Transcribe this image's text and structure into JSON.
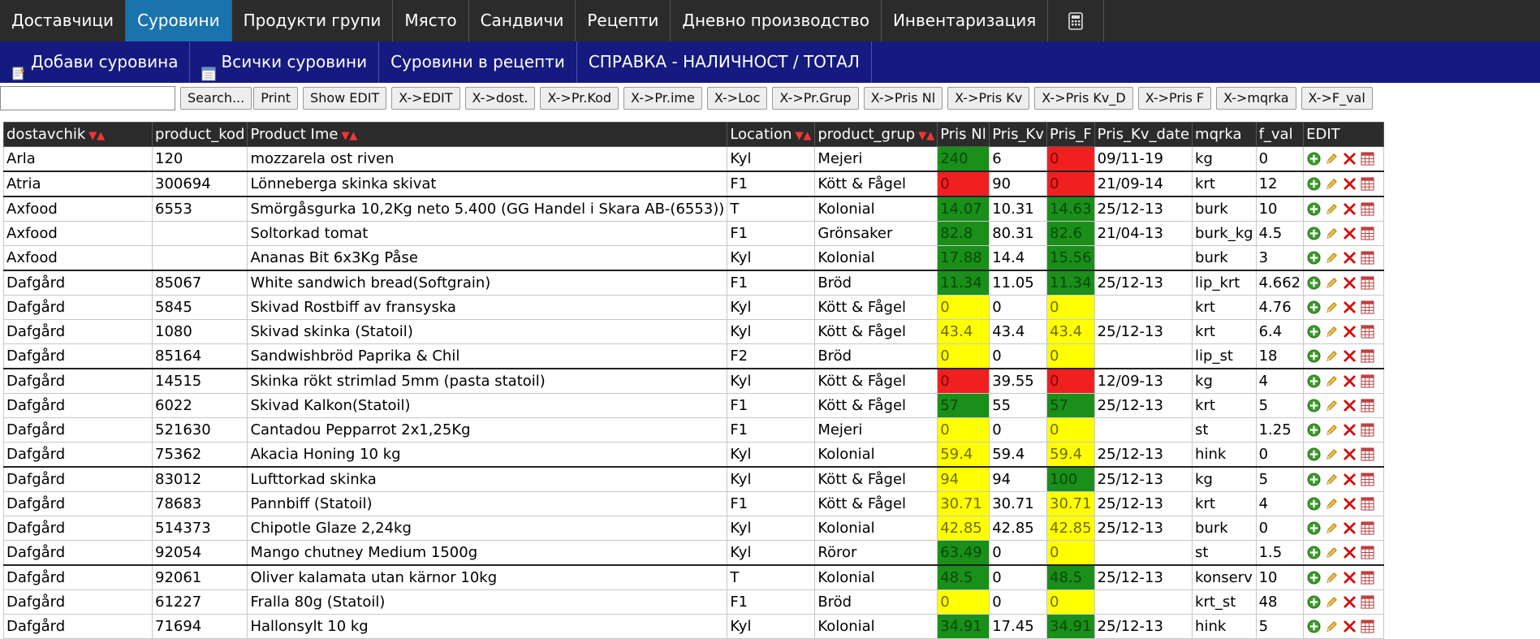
{
  "topnav": [
    "Доставчици",
    "Суровини",
    "Продукти групи",
    "Място",
    "Сандвичи",
    "Рецепти",
    "Дневно производство",
    "Инвентаризация"
  ],
  "subnav": [
    "Добави суровина",
    "Всички суровини",
    "Суровини в рецепти",
    "СПРАВКА - НАЛИЧНОСТ / ТОТАЛ"
  ],
  "toolbar": {
    "search_value": "",
    "buttons": [
      "Search...",
      "Print",
      "Show EDIT",
      "X->EDIT",
      "X->dost.",
      "X->Pr.Kod",
      "X->Pr.ime",
      "X->Loc",
      "X->Pr.Grup",
      "X->Pris Nl",
      "X->Pris Kv",
      "X->Pris Kv_D",
      "X->Pris F",
      "X->mqrka",
      "X->F_val"
    ]
  },
  "table": {
    "headers": [
      "dostavchik",
      "product_kod",
      "Product Ime",
      "Location",
      "product_grup",
      "Pris Nl",
      "Pris_Kv",
      "Pris_F",
      "Pris_Kv_date",
      "mqrka",
      "f_val",
      "EDIT"
    ],
    "rows": [
      [
        "Arla",
        "120",
        "mozzarela ost riven",
        "Kyl",
        "Mejeri",
        "240",
        "6",
        "0",
        "09/11-19",
        "kg",
        "0"
      ],
      [
        "Atria",
        "300694",
        "Lönneberga skinka skivat",
        "F1",
        "Kött & Fågel",
        "0",
        "90",
        "0",
        "21/09-14",
        "krt",
        "12"
      ],
      [
        "Axfood",
        "6553",
        "Smörgåsgurka 10,2Kg neto 5.400 (GG Handel i Skara AB-(6553))",
        "T",
        "Kolonial",
        "14.07",
        "10.31",
        "14.63",
        "25/12-13",
        "burk",
        "10"
      ],
      [
        "Axfood",
        "",
        "Soltorkad tomat",
        "F1",
        "Grönsaker",
        "82.8",
        "80.31",
        "82.6",
        "21/04-13",
        "burk_kg",
        "4.5"
      ],
      [
        "Axfood",
        "",
        "Ananas Bit 6x3Kg Påse",
        "Kyl",
        "Kolonial",
        "17.88",
        "14.4",
        "15.56",
        "",
        "burk",
        "3"
      ],
      [
        "Dafgård",
        "85067",
        "White sandwich bread(Softgrain)",
        "F1",
        "Bröd",
        "11.34",
        "11.05",
        "11.34",
        "25/12-13",
        "lip_krt",
        "4.662"
      ],
      [
        "Dafgård",
        "5845",
        "Skivad Rostbiff av fransyska",
        "Kyl",
        "Kött & Fågel",
        "0",
        "0",
        "0",
        "",
        "krt",
        "4.76"
      ],
      [
        "Dafgård",
        "1080",
        "Skivad skinka (Statoil)",
        "Kyl",
        "Kött & Fågel",
        "43.4",
        "43.4",
        "43.4",
        "25/12-13",
        "krt",
        "6.4"
      ],
      [
        "Dafgård",
        "85164",
        "Sandwishbröd Paprika & Chil",
        "F2",
        "Bröd",
        "0",
        "0",
        "0",
        "",
        "lip_st",
        "18"
      ],
      [
        "Dafgård",
        "14515",
        "Skinka rökt strimlad 5mm (pasta statoil)",
        "Kyl",
        "Kött & Fågel",
        "0",
        "39.55",
        "0",
        "12/09-13",
        "kg",
        "4"
      ],
      [
        "Dafgård",
        "6022",
        "Skivad Kalkon(Statoil)",
        "F1",
        "Kött & Fågel",
        "57",
        "55",
        "57",
        "25/12-13",
        "krt",
        "5"
      ],
      [
        "Dafgård",
        "521630",
        "Cantadou Pepparrot 2x1,25Kg",
        "F1",
        "Mejeri",
        "0",
        "0",
        "0",
        "",
        "st",
        "1.25"
      ],
      [
        "Dafgård",
        "75362",
        "Akacia Honing 10 kg",
        "Kyl",
        "Kolonial",
        "59.4",
        "59.4",
        "59.4",
        "25/12-13",
        "hink",
        "0"
      ],
      [
        "Dafgård",
        "83012",
        "Lufttorkad skinka",
        "Kyl",
        "Kött & Fågel",
        "94",
        "94",
        "100",
        "25/12-13",
        "kg",
        "5"
      ],
      [
        "Dafgård",
        "78683",
        "Pannbiff (Statoil)",
        "F1",
        "Kött & Fågel",
        "30.71",
        "30.71",
        "30.71",
        "25/12-13",
        "krt",
        "4"
      ],
      [
        "Dafgård",
        "514373",
        "Chipotle Glaze 2,24kg",
        "Kyl",
        "Kolonial",
        "42.85",
        "42.85",
        "42.85",
        "25/12-13",
        "burk",
        "0"
      ],
      [
        "Dafgård",
        "92054",
        "Mango chutney Medium 1500g",
        "Kyl",
        "Röror",
        "63.49",
        "0",
        "0",
        "",
        "st",
        "1.5"
      ],
      [
        "Dafgård",
        "92061",
        "Oliver kalamata utan kärnor 10kg",
        "T",
        "Kolonial",
        "48.5",
        "0",
        "48.5",
        "25/12-13",
        "konserv",
        "10"
      ],
      [
        "Dafgård",
        "61227",
        "Fralla 80g (Statoil)",
        "F1",
        "Bröd",
        "0",
        "0",
        "0",
        "",
        "krt_st",
        "48"
      ],
      [
        "Dafgård",
        "71694",
        "Hallonsylt 10 kg",
        "Kyl",
        "Kolonial",
        "34.91",
        "17.45",
        "34.91",
        "25/12-13",
        "hink",
        "5"
      ]
    ],
    "colors": {
      "Pris_Nl": [
        "green",
        "red",
        "green",
        "green",
        "green",
        "green",
        "yellow",
        "yellow",
        "yellow",
        "red",
        "green",
        "yellow",
        "yellow",
        "yellow",
        "yellow",
        "yellow",
        "green",
        "green",
        "yellow",
        "green"
      ],
      "Pris_F": [
        "red",
        "red",
        "green",
        "green",
        "green",
        "green",
        "yellow",
        "yellow",
        "yellow",
        "red",
        "green",
        "yellow",
        "yellow",
        "green",
        "yellow",
        "yellow",
        "yellow",
        "green",
        "yellow",
        "green"
      ]
    },
    "separator_rows": [
      1,
      2,
      5,
      9,
      13,
      17
    ]
  },
  "colors": {
    "active_tab": "#1a73ad",
    "subnav_bg": "#151a80",
    "green": "#1a8f1a",
    "red": "#f02020",
    "yellow": "#ffff00"
  }
}
